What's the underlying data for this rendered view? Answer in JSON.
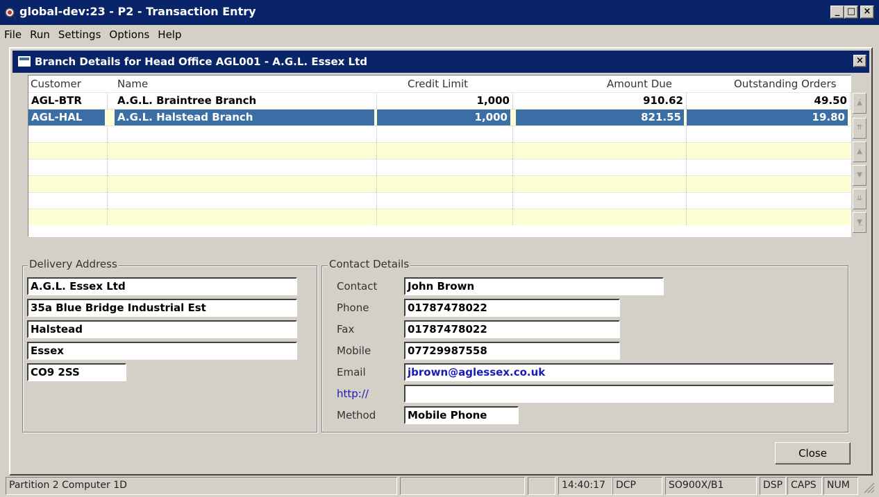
{
  "window": {
    "title": "global-dev:23 - P2 - Transaction Entry",
    "min_label": "_",
    "max_label": "□",
    "close_label": "×"
  },
  "menu": [
    "File",
    "Run",
    "Settings",
    "Options",
    "Help"
  ],
  "dialog": {
    "title": "Branch Details for Head Office AGL001 - A.G.L. Essex Ltd",
    "close_label": "×"
  },
  "grid": {
    "columns": [
      "Customer",
      "Name",
      "Credit Limit",
      "Amount Due",
      "Outstanding Orders"
    ],
    "rows": [
      {
        "customer": "AGL-BTR",
        "name": "A.G.L. Braintree Branch",
        "credit_limit": "1,000",
        "amount_due": "910.62",
        "outstanding": "49.50"
      },
      {
        "customer": "AGL-HAL",
        "name": "A.G.L. Halstead Branch",
        "credit_limit": "1,000",
        "amount_due": "821.55",
        "outstanding": "19.80"
      }
    ],
    "selected_row": 1
  },
  "delivery": {
    "legend": "Delivery Address",
    "line1": "A.G.L. Essex Ltd",
    "line2": "35a Blue Bridge Industrial Est",
    "line3": "Halstead",
    "line4": "Essex",
    "postcode": "CO9 2SS"
  },
  "contact": {
    "legend": "Contact Details",
    "labels": {
      "contact": "Contact",
      "phone": "Phone",
      "fax": "Fax",
      "mobile": "Mobile",
      "email": "Email",
      "web": "http://",
      "method": "Method"
    },
    "values": {
      "contact": "John Brown",
      "phone": "01787478022",
      "fax": "01787478022",
      "mobile": "07729987558",
      "email": "jbrown@aglessex.co.uk",
      "web": "",
      "method": "Mobile Phone"
    }
  },
  "buttons": {
    "close": "Close"
  },
  "statusbar": {
    "partition": "Partition 2 Computer 1D",
    "p2": "",
    "p3": "",
    "time": "14:40:17",
    "mode": "DCP",
    "ref": "SO900X/B1",
    "dsp": "DSP",
    "caps": "CAPS",
    "num": "NUM"
  },
  "colors": {
    "titlebar": "#0a246a",
    "selection": "#3a6ea5",
    "row_alt": "#ffffd6",
    "link": "#1a1ab8"
  }
}
